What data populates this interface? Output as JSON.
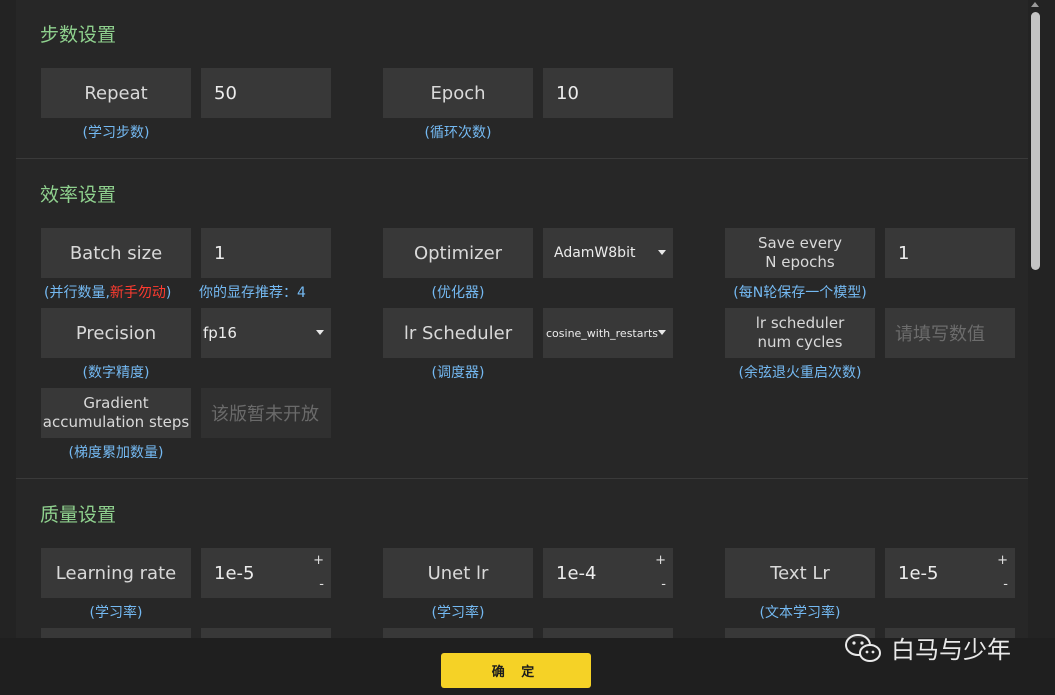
{
  "sections": {
    "steps": {
      "title": "步数设置",
      "repeat": {
        "label": "Repeat",
        "value": "50",
        "hint": "(学习步数)"
      },
      "epoch": {
        "label": "Epoch",
        "value": "10",
        "hint": "(循环次数)"
      }
    },
    "efficiency": {
      "title": "效率设置",
      "batch_size": {
        "label": "Batch size",
        "value": "1",
        "hint_prefix": "(并行数量,",
        "hint_warn": "新手勿动",
        "hint_suffix": ")",
        "vram_hint": "你的显存推荐：4"
      },
      "optimizer": {
        "label": "Optimizer",
        "value": "AdamW8bit",
        "hint": "(优化器)"
      },
      "save_every": {
        "label_line1": "Save every",
        "label_line2": "N epochs",
        "value": "1",
        "hint": "(每N轮保存一个模型)"
      },
      "precision": {
        "label": "Precision",
        "value": "fp16",
        "hint": "(数字精度)"
      },
      "lr_scheduler": {
        "label": "lr Scheduler",
        "value": "cosine_with_restarts",
        "hint": "(调度器)"
      },
      "lr_cycles": {
        "label_line1": "lr scheduler",
        "label_line2": "num cycles",
        "placeholder": "请填写数值",
        "hint": "(余弦退火重启次数)"
      },
      "grad_accum": {
        "label_line1": "Gradient",
        "label_line2": "accumulation steps",
        "placeholder": "该版暂未开放",
        "hint": "(梯度累加数量)"
      }
    },
    "quality": {
      "title": "质量设置",
      "learning_rate": {
        "label": "Learning rate",
        "value": "1e-5",
        "hint": "(学习率)"
      },
      "unet_lr": {
        "label": "Unet lr",
        "value": "1e-4",
        "hint": "(学习率)"
      },
      "text_lr": {
        "label": "Text Lr",
        "value": "1e-5",
        "hint": "(文本学习率)"
      }
    }
  },
  "stepper": {
    "plus": "+",
    "minus": "-"
  },
  "confirm_label": "确 定",
  "watermark_text": "白马与少年",
  "colors": {
    "section_title": "#8fd18e",
    "hint": "#74b9f2",
    "warn": "#ff3b30",
    "confirm": "#f5d226"
  }
}
